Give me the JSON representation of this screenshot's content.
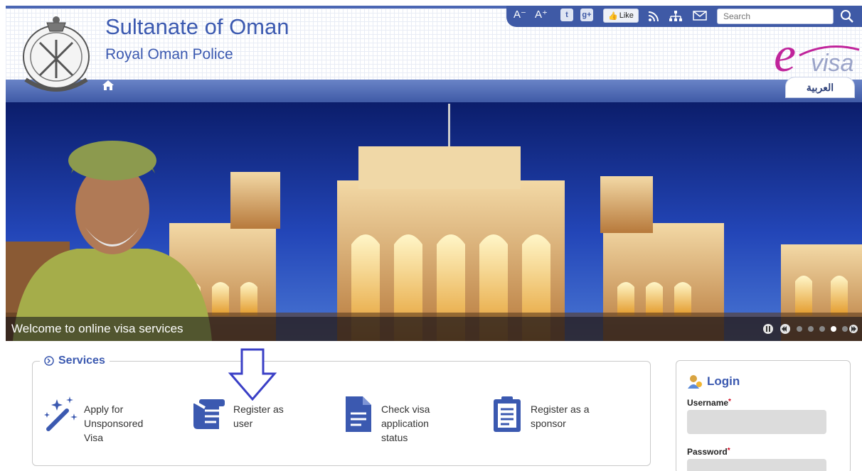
{
  "header": {
    "title": "Sultanate of Oman",
    "subtitle": "Royal Oman Police",
    "language_tab": "العربية"
  },
  "utility_bar": {
    "font_decrease": "A⁻",
    "font_increase": "A⁺",
    "like_label": "Like",
    "search_placeholder": "Search",
    "icons": [
      "font-decrease-icon",
      "font-increase-icon",
      "twitter-icon",
      "google-plus-icon",
      "facebook-like-icon",
      "rss-icon",
      "sitemap-icon",
      "mail-icon",
      "search-icon"
    ]
  },
  "banner": {
    "caption": "Welcome to online visa services"
  },
  "services": {
    "heading": "Services",
    "items": [
      {
        "label": "Apply for Unsponsored Visa",
        "icon": "magic-wand-icon"
      },
      {
        "label": "Register as user",
        "icon": "scroll-register-icon"
      },
      {
        "label": "Check visa application status",
        "icon": "document-icon"
      },
      {
        "label": "Register as a sponsor",
        "icon": "clipboard-icon"
      }
    ]
  },
  "login": {
    "heading": "Login",
    "username_label": "Username",
    "password_label": "Password"
  },
  "colors": {
    "brand_blue": "#3b59b0",
    "navbar_dark": "#3f5aa6"
  }
}
